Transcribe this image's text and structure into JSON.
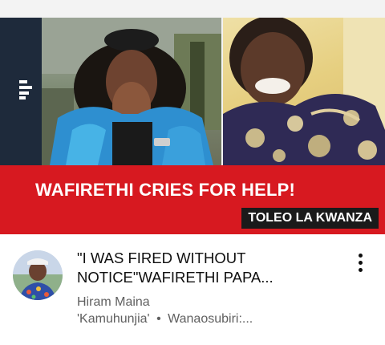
{
  "thumbnail": {
    "headline": "WAFIRETHI CRIES FOR HELP!",
    "tag": "TOLEO LA KWANZA",
    "colors": {
      "banner": "#d71920",
      "band": "#1e2a3b",
      "tag_bg": "#1a1a1a"
    }
  },
  "video": {
    "title_line1": "\"I WAS FIRED WITHOUT",
    "title_line2": "NOTICE\"WAFIRETHI PAPA...",
    "channel": "Hiram Maina",
    "subline_part1": "'Kamuhunjia'",
    "separator": "•",
    "subline_part2": "Wanaosubiri:..."
  },
  "icons": {
    "menu": "kebab-menu-icon",
    "logo": "channel-logo-icon"
  }
}
